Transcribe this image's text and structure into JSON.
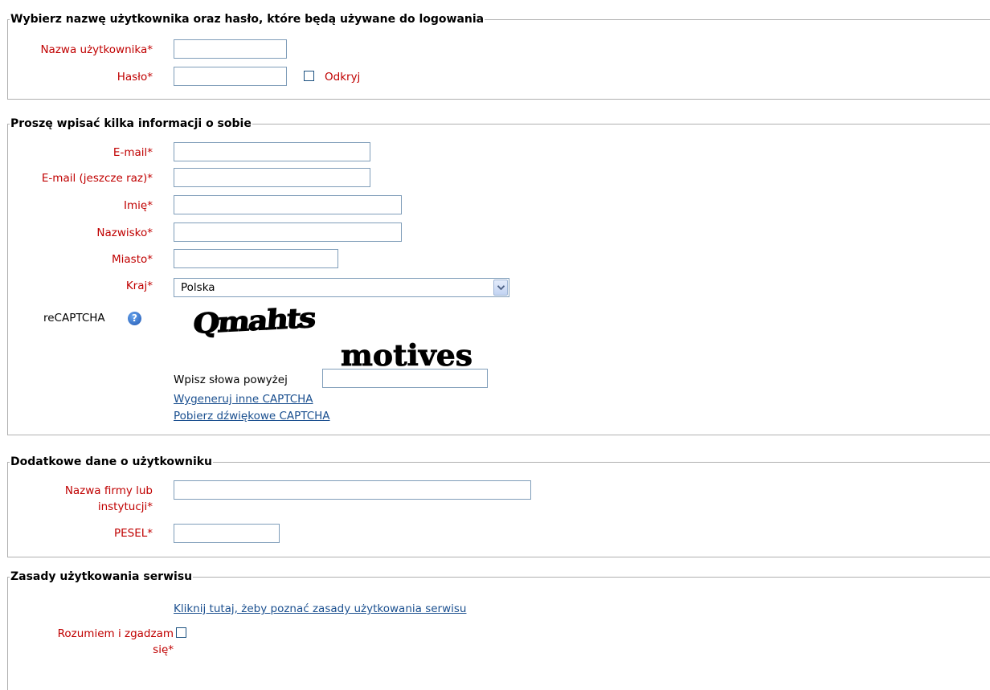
{
  "login_section": {
    "legend": "Wybierz nazwę użytkownika oraz hasło, które będą używane do logowania",
    "username_label": "Nazwa użytkownika",
    "password_label": "Hasło",
    "reveal_label": "Odkryj",
    "required_mark": "*"
  },
  "about_section": {
    "legend": "Proszę wpisać kilka informacji o sobie",
    "email_label": "E-mail",
    "email_again_label": "E-mail (jeszcze raz)",
    "first_name_label": "Imię",
    "last_name_label": "Nazwisko",
    "city_label": "Miasto",
    "country_label": "Kraj",
    "country_value": "Polska",
    "recaptcha_label": "reCAPTCHA",
    "captcha_word_1": "Qmahts",
    "captcha_word_2": "motives",
    "captcha_prompt": "Wpisz słowa powyżej",
    "captcha_new_link": "Wygeneruj inne CAPTCHA",
    "captcha_audio_link": "Pobierz dźwiękowe CAPTCHA"
  },
  "extra_section": {
    "legend": "Dodatkowe dane o użytkowniku",
    "company_label_line1": "Nazwa firmy lub",
    "company_label_line2": "instytucji",
    "pesel_label": "PESEL"
  },
  "terms_section": {
    "legend": "Zasady użytkowania serwisu",
    "terms_link": "Kliknij tutaj, żeby poznać zasady użytkowania serwisu",
    "agree_label_line1": "Rozumiem i zgadzam",
    "agree_label_line2": "się"
  },
  "colors": {
    "label_red": "#c00000",
    "link_blue": "#1a4f8f",
    "input_border": "#7f9db9"
  }
}
